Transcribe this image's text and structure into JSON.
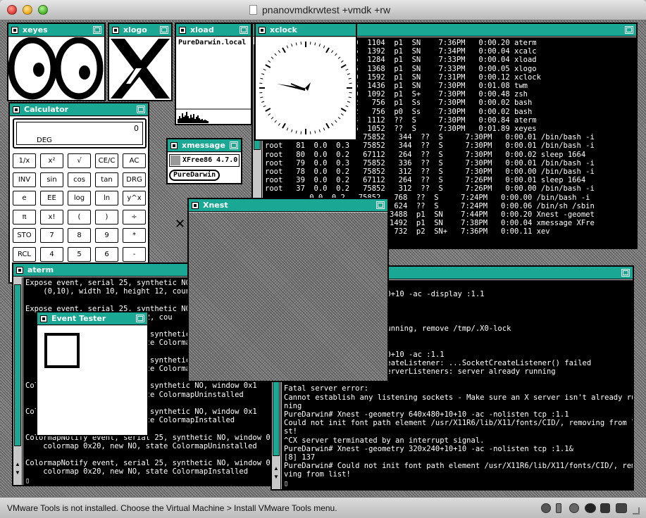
{
  "window": {
    "title": "pnanovmdkrwtest +vmdk +rw"
  },
  "status_bar": {
    "text": "VMware Tools is not installed. Choose the Virtual Machine > Install VMware Tools menu.",
    "icons": [
      "cdrom-icon",
      "bluetooth-icon",
      "network-icon",
      "usb-icon",
      "camera-icon",
      "keyboard-icon",
      "resize-grip-icon"
    ]
  },
  "xeyes": {
    "title": "xeyes"
  },
  "xlogo": {
    "title": "xlogo"
  },
  "xload": {
    "title": "xload",
    "host": "PureDarwin.local"
  },
  "xclock": {
    "title": "xclock"
  },
  "calculator": {
    "title": "Calculator",
    "display_value": "0",
    "mode": "DEG",
    "rows": [
      [
        "1/x",
        "x²",
        "√",
        "CE/C",
        "AC"
      ],
      [
        "INV",
        "sin",
        "cos",
        "tan",
        "DRG"
      ],
      [
        "e",
        "EE",
        "log",
        "ln",
        "y^x"
      ],
      [
        "π",
        "x!",
        "(",
        ")",
        "÷"
      ],
      [
        "STO",
        "7",
        "8",
        "9",
        "*"
      ],
      [
        "RCL",
        "4",
        "5",
        "6",
        "-"
      ]
    ]
  },
  "xmessage": {
    "title": "xmessage",
    "message": "XFree86 4.7.0",
    "button": "PureDarwin"
  },
  "xnest": {
    "title": "Xnest"
  },
  "ps_terminal": {
    "lines": [
      "          0.8   76620  1104  p1  SN    7:36PM   0:00.20 aterm",
      "          1.1   77376  1392  p1  SN    7:34PM   0:00.04 xcalc",
      "          1.0   77396  1284  p1  SN    7:33PM   0:00.04 xload",
      "          1.0   78176  1368  p1  SN    7:33PM   0:00.05 xlogo",
      "          1.2   78180  1592  p1  SN    7:31PM   0:00.12 xclock",
      "          1.1   77396  1436  p1  SN    7:30PM   0:01.08 twm",
      "          0.8   77140  1092  p1  S+    7:30PM   0:00.48 zsh",
      "          0.6   75852   756  p1  Ss    7:30PM   0:00.02 bash",
      "          0.6   75852   756  p0  Ss    7:30PM   0:00.02 bash",
      "          0.8   77644  1112  ??  S     7:30PM   0:00.84 aterm",
      "          0.8   77036  1052  ??  S     7:30PM   0:01.89 xeyes",
      "root   82  0.0  0.3   75852   344  ??  S     7:30PM   0:00.01 /bin/bash -i",
      "root   81  0.0  0.3   75852   344  ??  S     7:30PM   0:00.01 /bin/bash -i",
      "root   80  0.0  0.2   67112   264  ??  S     7:30PM   0:00.02 sleep 1664",
      "root   79  0.0  0.3   75852   336  ??  S     7:30PM   0:00.01 /bin/bash -i",
      "root   78  0.0  0.2   75852   312  ??  S     7:30PM   0:00.00 /bin/bash -i",
      "root   39  0.0  0.2   67112   264  ??  S     7:26PM   0:00.01 sleep 1664",
      "root   37  0.0  0.2   75852   312  ??  S     7:26PM   0:00.00 /bin/bash -i",
      "          0.0  0.2   75852   768  ??  S     7:24PM   0:00.00 /bin/bash -i",
      "          0.0  0.2   75852   624  ??  S     7:24PM   0:00.06 /bin/sh /sbin",
      "          0.0  0.3   81048  3488  p1  SN    7:44PM   0:00.20 Xnest -geomet",
      "          0.0  0.2   77376  1492  p1  SN    7:38PM   0:00.04 xmessage XFre",
      "          0.0  0.2   76340   732  p2  SN+   7:36PM   0:00.11 xev"
    ]
  },
  "aterm": {
    "title": "aterm",
    "lines": [
      "Expose event, serial 25, synthetic NO, window 0x1",
      "    (0,10), width 10, height 12, count",
      "",
      "Expose event, serial 25, synthetic NO, window 0x1",
      "                        t 12, cou",
      "",
      "                        25, synthetic NO, window 0x1",
      "                        state ColormapInstalled",
      "",
      "                        25, synthetic NO, window 0x1",
      "                        state ColormapInstalled",
      "",
      "Colo                    25, synthetic NO, window 0x1",
      "                        state ColormapUninstalled",
      "",
      "Colo                    25, synthetic NO, window 0x1",
      "                        state ColormapInstalled",
      "",
      "ColormapNotify event, serial 25, synthetic NO, window 0x1",
      "    colormap 0x20, new NO, state ColormapUninstalled",
      "",
      "ColormapNotify event, serial 25, synthetic NO, window 0x1",
      "    colormap 0x20, new NO, state ColormapInstalled",
      "▯"
    ]
  },
  "event_tester": {
    "title": "Event Tester"
  },
  "xnest_terminal": {
    "lines": [
      "",
      "          try 640x480+10+10 -ac -display :1.1",
      "",
      "",
      "          for display 0",
      "          s no longer running, remove /tmp/.X0-lock",
      "",
      "",
      "          try 640x480+10+10 -ac :1.1",
      "_XSERVTransSocketINETCreateListener: ...SocketCreateListener() failed",
      "_XSERVTransMakeAllCOTSServerListeners: server already running",
      "",
      "Fatal server error:",
      "Cannot establish any listening sockets - Make sure an X server isn't already run",
      "ning",
      "PureDarwin# Xnest -geometry 640x480+10+10 -ac -nolisten tcp :1.1",
      "Could not init font path element /usr/X11R6/lib/X11/fonts/CID/, removing from li",
      "st!",
      "^CX server terminated by an interrupt signal.",
      "PureDarwin# Xnest -geometry 320x240+10+10 -ac -nolisten tcp :1.1&",
      "[8] 137",
      "PureDarwin# Could not init font path element /usr/X11R6/lib/X11/fonts/CID/, remo",
      "ving from list!",
      "▯"
    ]
  }
}
